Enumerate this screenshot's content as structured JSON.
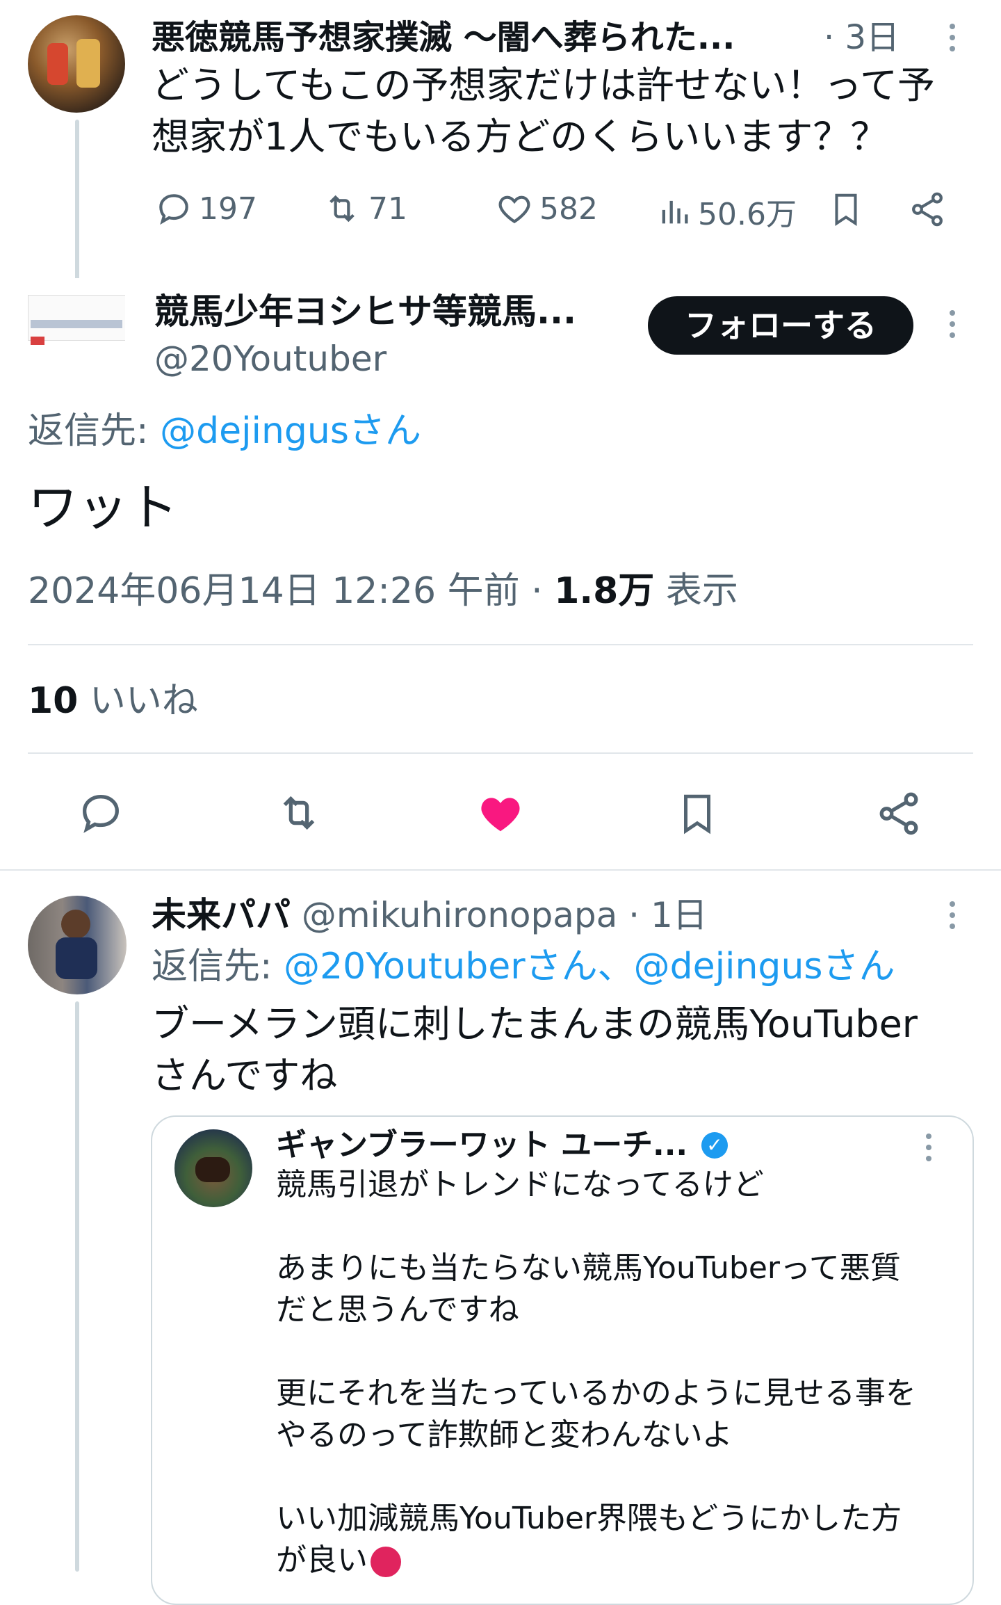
{
  "tweet1": {
    "name": "悪徳競馬予想家撲滅 〜闇へ葬られた...",
    "time": "· 3日",
    "text_line1": "どうしてもこの予想家だけは許せない！って予",
    "text_line2": "想家が1人でもいる方どのくらいいます？？",
    "replies": "197",
    "retweets": "71",
    "likes": "582",
    "views": "50.6万"
  },
  "main": {
    "name": "競馬少年ヨシヒサ等競馬...",
    "handle": "@20Youtuber",
    "follow_label": "フォローする",
    "reply_prefix": "返信先: ",
    "reply_to": "@dejingusさん",
    "text": "ワット",
    "timestamp": "2024年06月14日 12:26 午前 · ",
    "view_count": "1.8万",
    "view_label": " 表示",
    "like_count": "10",
    "like_label": " いいね",
    "liked_color": "#f91880"
  },
  "reply": {
    "name": "未来パパ",
    "handle": " @mikuhironopapa",
    "time": " · 1日",
    "reply_prefix": "返信先: ",
    "reply_to": "@20Youtuberさん、@dejingusさん",
    "text_line1": "ブーメラン頭に刺したまんまの競馬YouTuber",
    "text_line2": "さんですね",
    "quote": {
      "name": "ギャンブラーワット ユーチ...",
      "verified_color": "#1d9bf0",
      "line1": "競馬引退がトレンドになってるけど",
      "line2": "あまりにも当たらない競馬YouTuberって悪質",
      "line3": "だと思うんですね",
      "line4": "更にそれを当たっているかのように見せる事を",
      "line5": "やるのって詐欺師と変わんないよ",
      "line6": "いい加減競馬YouTuber界隈もどうにかした方",
      "line7": "が良い"
    }
  },
  "icons": {
    "reply": "reply-icon",
    "retweet": "retweet-icon",
    "like": "heart-icon",
    "views": "views-icon",
    "bookmark": "bookmark-icon",
    "share": "share-icon",
    "more": "more-icon"
  }
}
